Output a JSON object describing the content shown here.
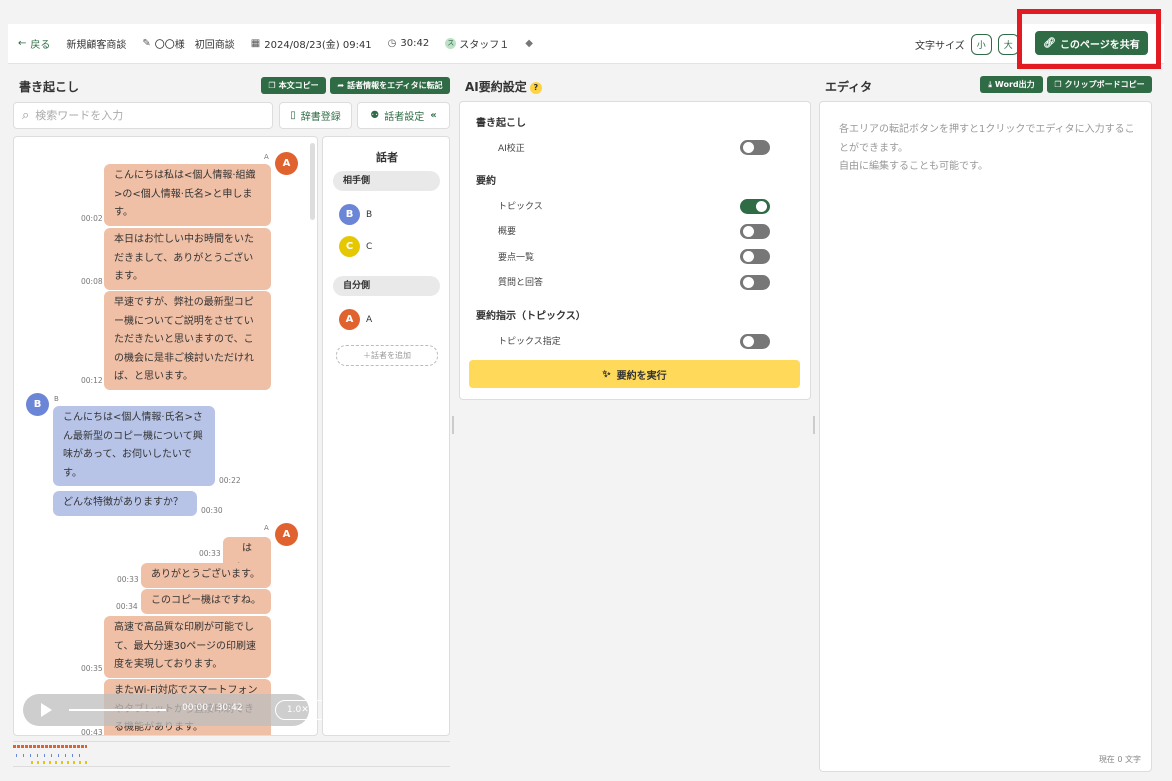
{
  "header": {
    "back": "戻る",
    "meeting_type": "新規顧客商談",
    "title": "〇〇様　初回商談",
    "datetime": "2024/08/23(金) 09:41",
    "duration": "30:42",
    "staff": "スタッフ１",
    "font_size_label": "文字サイズ",
    "font_small": "小",
    "font_large": "大",
    "share": "このページを共有"
  },
  "transcript": {
    "title": "書き起こし",
    "copy_btn": "本文コピー",
    "transfer_btn": "話者情報をエディタに転記",
    "search_placeholder": "検索ワードを入力",
    "dict_btn": "辞書登録",
    "speaker_btn": "話者設定",
    "messages": [
      {
        "speaker": "A",
        "text": "こんにちは私は<個人情報·組織>の<個人情報·氏名>と申します。",
        "time": "00:02"
      },
      {
        "speaker": "A",
        "text": "本日はお忙しい中お時間をいただきまして、ありがとうございます。",
        "time": "00:08"
      },
      {
        "speaker": "A",
        "text": "早速ですが、弊社の最新型コピー機についてご説明をさせていただきたいと思いますので、この機会に是非ご検討いただければ、と思います。",
        "time": "00:12"
      },
      {
        "speaker": "B",
        "text": "こんにちは<個人情報·氏名>さん最新型のコピー機について興味があって、お伺いしたいです。",
        "time": "00:22"
      },
      {
        "speaker": "B",
        "text": "どんな特徴がありますか？",
        "time": "00:30"
      },
      {
        "speaker": "A",
        "text": "はい。",
        "time": "00:33"
      },
      {
        "speaker": "A",
        "text": "ありがとうございます。",
        "time": "00:33"
      },
      {
        "speaker": "A",
        "text": "このコピー機はですね。",
        "time": "00:34"
      },
      {
        "speaker": "A",
        "text": "高速で高品質な印刷が可能でして、最大分速30ページの印刷速度を実現しております。",
        "time": "00:35"
      },
      {
        "speaker": "A",
        "text": "またWi‐Fi対応でスマートフォンやタブレットから直接印刷できる機能があります。",
        "time": "00:43"
      }
    ],
    "player": {
      "time": "00:00 / 30:42",
      "speed": "1.0✕",
      "progress": 0
    }
  },
  "speakers": {
    "title": "話者",
    "other_label": "相手側",
    "self_label": "自分側",
    "other": [
      "B",
      "C"
    ],
    "self": [
      "A"
    ],
    "add": "＋話者を追加",
    "colors": {
      "A": "#e0622f",
      "B": "#6b86d6",
      "C": "#e6c800"
    }
  },
  "ai": {
    "title": "AI要約設定",
    "help": "?",
    "section_transcript": "書き起こし",
    "ai_correct": "AI校正",
    "section_summary": "要約",
    "topics": "トピックス",
    "overview": "概要",
    "key_points": "要点一覧",
    "qa": "質問と回答",
    "section_instruct": "要約指示（トピックス）",
    "topic_spec": "トピックス指定",
    "run": "要約を実行",
    "toggles": {
      "ai_correct": false,
      "topics": true,
      "overview": false,
      "key_points": false,
      "qa": false,
      "topic_spec": false
    }
  },
  "editor": {
    "title": "エディタ",
    "word_btn": "Word出力",
    "clip_btn": "クリップボードコピー",
    "placeholder_1": "各エリアの転記ボタンを押すと1クリックでエディタに入力することができます。",
    "placeholder_2": "自由に編集することも可能です。",
    "count": "現在 0 文字"
  },
  "theme": {
    "accent": "#2f6b45",
    "speaker_a": "#efbfa6",
    "speaker_b": "#b7c4e8",
    "run": "#ffd95a",
    "highlight": "#e21b23"
  }
}
